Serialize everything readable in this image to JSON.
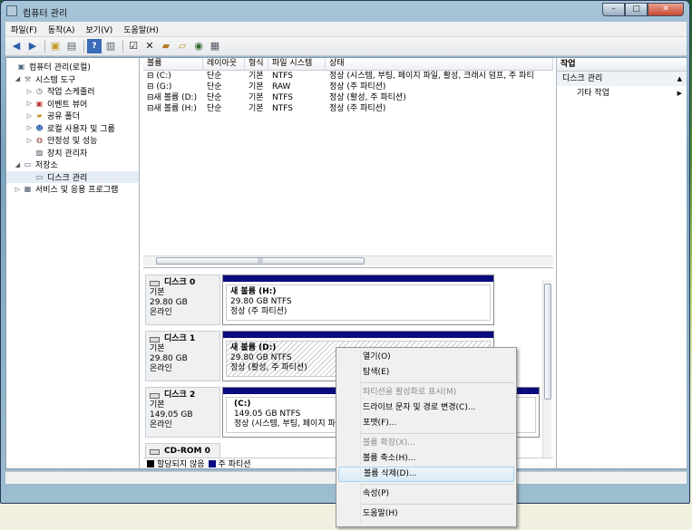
{
  "window": {
    "title": "컴퓨터 관리",
    "minimize": "–",
    "maximize": "□",
    "close": "✕"
  },
  "menu": [
    "파일(F)",
    "동작(A)",
    "보기(V)",
    "도움말(H)"
  ],
  "tree": [
    {
      "label": "컴퓨터 관리(로컬)",
      "icon": "computer-icon",
      "expander": ""
    },
    {
      "label": "시스템 도구",
      "icon": "tools-icon",
      "expander": "◢"
    },
    {
      "label": "작업 스케줄러",
      "icon": "clock-icon",
      "expander": "▷"
    },
    {
      "label": "이벤트 뷰어",
      "icon": "event-viewer-icon",
      "expander": "▷"
    },
    {
      "label": "공유 폴더",
      "icon": "shared-folder-icon",
      "expander": "▷"
    },
    {
      "label": "로컬 사용자 및 그룹",
      "icon": "users-icon",
      "expander": "▷"
    },
    {
      "label": "안정성 및 성능",
      "icon": "performance-icon",
      "expander": "▷"
    },
    {
      "label": "장치 관리자",
      "icon": "device-manager-icon",
      "expander": ""
    },
    {
      "label": "저장소",
      "icon": "storage-icon",
      "expander": "◢"
    },
    {
      "label": "디스크 관리",
      "icon": "disk-management-icon",
      "expander": ""
    },
    {
      "label": "서비스 및 응용 프로그램",
      "icon": "services-icon",
      "expander": "▷"
    }
  ],
  "volumes": {
    "columns": [
      "볼륨",
      "레이아웃",
      "형식",
      "파일 시스템",
      "상태"
    ],
    "rows": [
      [
        "(C:)",
        "단순",
        "기본",
        "NTFS",
        "정상 (시스템, 부팅, 페이지 파일, 활성, 크래시 덤프, 주 파티"
      ],
      [
        "(G:)",
        "단순",
        "기본",
        "RAW",
        "정상 (주 파티션)"
      ],
      [
        "새 볼륨 (D:)",
        "단순",
        "기본",
        "NTFS",
        "정상 (활성, 주 파티션)"
      ],
      [
        "새 볼륨 (H:)",
        "단순",
        "기본",
        "NTFS",
        "정상 (주 파티션)"
      ]
    ]
  },
  "disks": [
    {
      "name": "디스크 0",
      "type": "기본",
      "size": "29.80 GB",
      "status": "온라인",
      "partition": {
        "name": "새 볼륨  (H:)",
        "detail": "29.80 GB NTFS",
        "status": "정상 (주 파티션)"
      }
    },
    {
      "name": "디스크 1",
      "type": "기본",
      "size": "29.80 GB",
      "status": "온라인",
      "partition": {
        "name": "새 볼륨  (D:)",
        "detail": "29.80 GB NTFS",
        "status": "정상 (활성, 주 파티션)"
      }
    },
    {
      "name": "디스크 2",
      "type": "기본",
      "size": "149.05 GB",
      "status": "온라인",
      "partition": {
        "name": "(C:)",
        "detail": "149.05 GB NTFS",
        "status": "정상 (시스템, 부팅, 페이지 파"
      }
    },
    {
      "name": "CD-ROM 0"
    }
  ],
  "legend": {
    "unallocated": "할당되지 않음",
    "primary": "주 파티션",
    "unallocated_color": "#000000",
    "primary_color": "#0b0b80"
  },
  "actions": {
    "header": "작업",
    "group": "디스크 관리",
    "item": "기타 작업"
  },
  "context_menu": [
    {
      "label": "열기(O)",
      "disabled": false
    },
    {
      "label": "탐색(E)",
      "disabled": false
    },
    {
      "sep": true
    },
    {
      "label": "파티션을 활성화로 표시(M)",
      "disabled": true
    },
    {
      "label": "드라이브 문자 및 경로 변경(C)...",
      "disabled": false
    },
    {
      "label": "포맷(F)...",
      "disabled": false
    },
    {
      "sep": true
    },
    {
      "label": "볼륨 확장(X)...",
      "disabled": true
    },
    {
      "label": "볼륨 축소(H)...",
      "disabled": false
    },
    {
      "label": "볼륨 삭제(D)...",
      "disabled": false,
      "highlighted": true
    },
    {
      "sep": true
    },
    {
      "label": "속성(P)",
      "disabled": false
    },
    {
      "sep": true
    },
    {
      "label": "도움말(H)",
      "disabled": false
    }
  ]
}
